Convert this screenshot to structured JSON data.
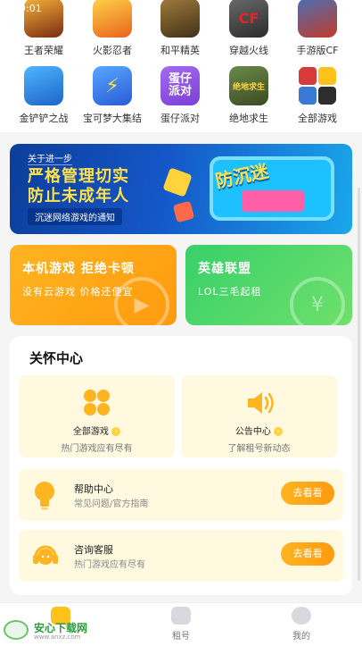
{
  "status": {
    "time": "9:01",
    "right": "0"
  },
  "games": [
    {
      "label": "王者荣耀",
      "icon": "wangzhe-icon",
      "glyph": ""
    },
    {
      "label": "火影忍者",
      "icon": "huoying-icon",
      "glyph": ""
    },
    {
      "label": "和平精英",
      "icon": "heping-icon",
      "glyph": ""
    },
    {
      "label": "穿越火线",
      "icon": "cf-icon",
      "glyph": "CF"
    },
    {
      "label": "手游版CF",
      "icon": "cf-mobile-icon",
      "glyph": ""
    },
    {
      "label": "金铲铲之战",
      "icon": "jinchan-icon",
      "glyph": ""
    },
    {
      "label": "宝可梦大集结",
      "icon": "pokemon-icon",
      "glyph": "⚡"
    },
    {
      "label": "蛋仔派对",
      "icon": "danzai-icon",
      "glyph": "蛋仔\n派对"
    },
    {
      "label": "绝地求生",
      "icon": "pubg-icon",
      "glyph": "绝地求生"
    },
    {
      "label": "全部游戏",
      "icon": "all-games-icon",
      "glyph": ""
    }
  ],
  "banner": {
    "tag": "关于进一步",
    "headline_1": "严格管理切实",
    "headline_2": "防止未成年人",
    "sub": "沉迷网络游戏的通知",
    "art_text": "防沉迷"
  },
  "promos": [
    {
      "title": "本机游戏 拒绝卡顿",
      "desc": "没有云游戏 价格还便宜",
      "glyph": "▶"
    },
    {
      "title": "英雄联盟",
      "desc": "LOL三毛起租",
      "glyph": "¥"
    }
  ],
  "care": {
    "title": "关怀中心",
    "tiles": [
      {
        "title": "全部游戏",
        "sub": "热门游戏应有尽有"
      },
      {
        "title": "公告中心",
        "sub": "了解租号新动态"
      }
    ],
    "rows": [
      {
        "title": "帮助中心",
        "sub": "常见问题/官方指南",
        "button": "去看看"
      },
      {
        "title": "咨询客服",
        "sub": "热门游戏应有尽有",
        "button": "去看看"
      }
    ]
  },
  "nav": [
    {
      "label": "",
      "icon": "home-icon"
    },
    {
      "label": "租号",
      "icon": "gamepad-icon"
    },
    {
      "label": "我的",
      "icon": "user-icon"
    }
  ],
  "watermark": {
    "title": "安心下载网",
    "url": "www.anxz.com"
  },
  "colors": {
    "accent": "#ffb421",
    "green": "#38d06a",
    "banner": "#1557c8"
  }
}
